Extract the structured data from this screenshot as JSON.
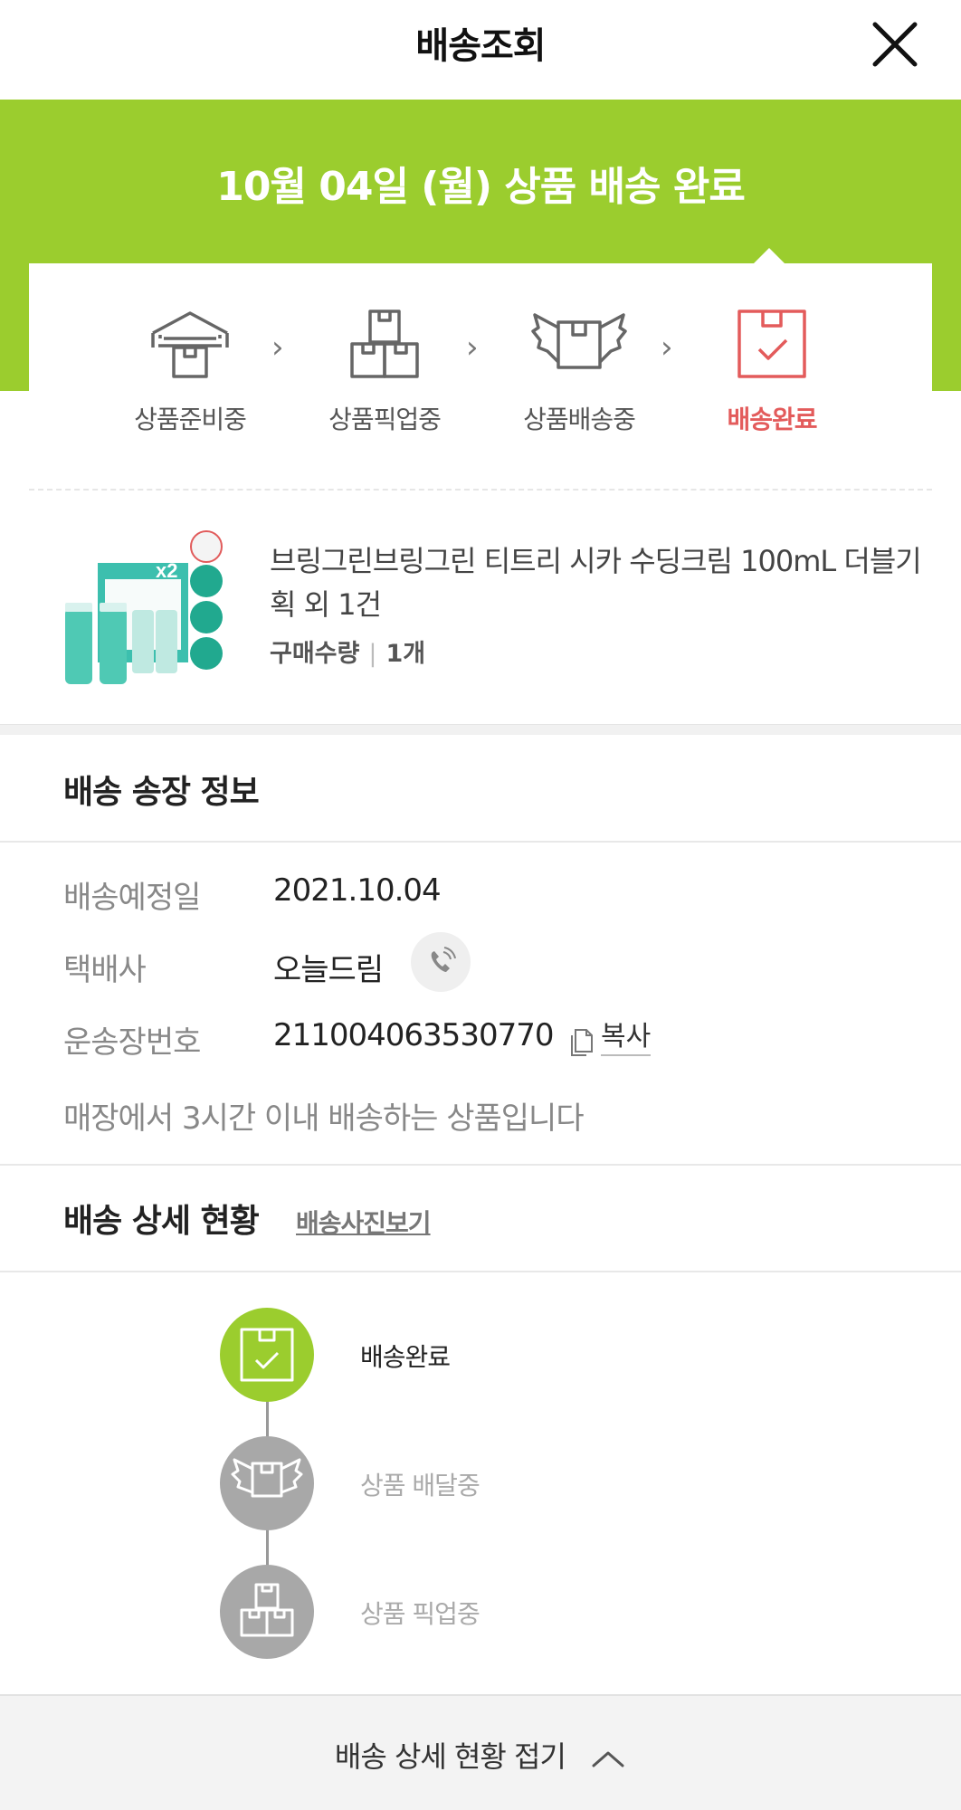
{
  "header": {
    "title": "배송조회"
  },
  "banner": {
    "status_title": "10월 04일 (월) 상품 배송 완료"
  },
  "steps": [
    {
      "label": "상품준비중",
      "active": false
    },
    {
      "label": "상품픽업중",
      "active": false
    },
    {
      "label": "상품배송중",
      "active": false
    },
    {
      "label": "배송완료",
      "active": true
    }
  ],
  "product": {
    "name": "브링그린브링그린 티트리 시카 수딩크림 100mL 더블기획 외 1건",
    "qty_label": "구매수량",
    "qty_value": "1개"
  },
  "invoice": {
    "title": "배송 송장 정보",
    "rows": [
      {
        "label": "배송예정일",
        "value": "2021.10.04"
      },
      {
        "label": "택배사",
        "value": "오늘드림"
      },
      {
        "label": "운송장번호",
        "value": "211004063530770"
      }
    ],
    "copy_label": "복사",
    "notice": "매장에서 3시간 이내 배송하는 상품입니다"
  },
  "detail": {
    "title": "배송 상세 현황",
    "photo_link": "배송사진보기",
    "timeline": [
      {
        "label": "배송완료",
        "active": true
      },
      {
        "label": "상품 배달중",
        "active": false
      },
      {
        "label": "상품 픽업중",
        "active": false
      }
    ],
    "collapse_label": "배송 상세 현황 접기"
  },
  "colors": {
    "brand_green": "#9bcd2e",
    "active_red": "#e35b5b",
    "inactive_gray": "#a8a8a8"
  }
}
